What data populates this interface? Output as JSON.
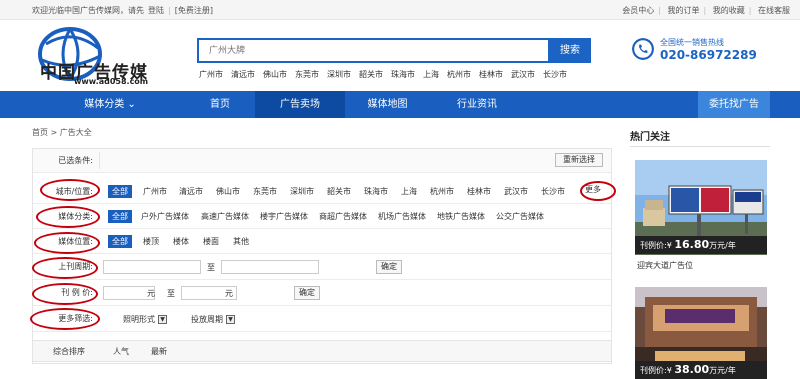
{
  "topbar": {
    "welcome": "欢迎光临中国广告传媒网，请先",
    "login": "登陆",
    "register": "[免费注册]",
    "links": [
      "会员中心",
      "我的订单",
      "我的收藏",
      "在线客服"
    ]
  },
  "logo": {
    "name": "中国广告传媒",
    "url": "www.ad058.com"
  },
  "search": {
    "placeholder": "广州大牌",
    "button": "搜索"
  },
  "hot_cities": [
    "广州市",
    "清远市",
    "佛山市",
    "东莞市",
    "深圳市",
    "韶关市",
    "珠海市",
    "上海",
    "杭州市",
    "桂林市",
    "武汉市",
    "长沙市"
  ],
  "hotline": {
    "title": "全国统一销售热线",
    "number": "020-86972289"
  },
  "nav": {
    "items": [
      "媒体分类",
      "首页",
      "广告卖场",
      "媒体地图",
      "行业资讯"
    ],
    "cta": "委托找广告"
  },
  "breadcrumb": {
    "home": "首页",
    "sep": ">",
    "current": "广告大全"
  },
  "filters": {
    "selected_label": "已选条件:",
    "reset": "重新选择",
    "city": {
      "label": "城市/位置:",
      "all": "全部",
      "more": "更多"
    },
    "media_type": {
      "label": "媒体分类:",
      "all": "全部",
      "options": [
        "户外广告媒体",
        "高速广告媒体",
        "楼宇广告媒体",
        "商超广告媒体",
        "机场广告媒体",
        "地铁广告媒体",
        "公交广告媒体"
      ]
    },
    "media_position": {
      "label": "媒体位置:",
      "all": "全部",
      "options": [
        "楼顶",
        "楼体",
        "楼面",
        "其他"
      ]
    },
    "period": {
      "label": "上刊周期:",
      "to": "至",
      "ok": "确定"
    },
    "price": {
      "label": "刊 例 价:",
      "unit": "元",
      "to": "至",
      "ok": "确定"
    },
    "more_filters": {
      "label": "更多筛选:",
      "lighting": "照明形式",
      "period": "投放周期"
    }
  },
  "sort": [
    "综合排序",
    "人气",
    "最新"
  ],
  "sidebar": {
    "title": "热门关注",
    "cards": [
      {
        "price_label": "刊例价:¥",
        "price": "16.80",
        "unit": "万元/年",
        "name": "迎宾大道广告位"
      },
      {
        "price_label": "刊例价:¥",
        "price": "38.00",
        "unit": "万元/年"
      }
    ]
  },
  "colors": {
    "brand": "#1a5fbf",
    "highlight": "#c4000d"
  }
}
